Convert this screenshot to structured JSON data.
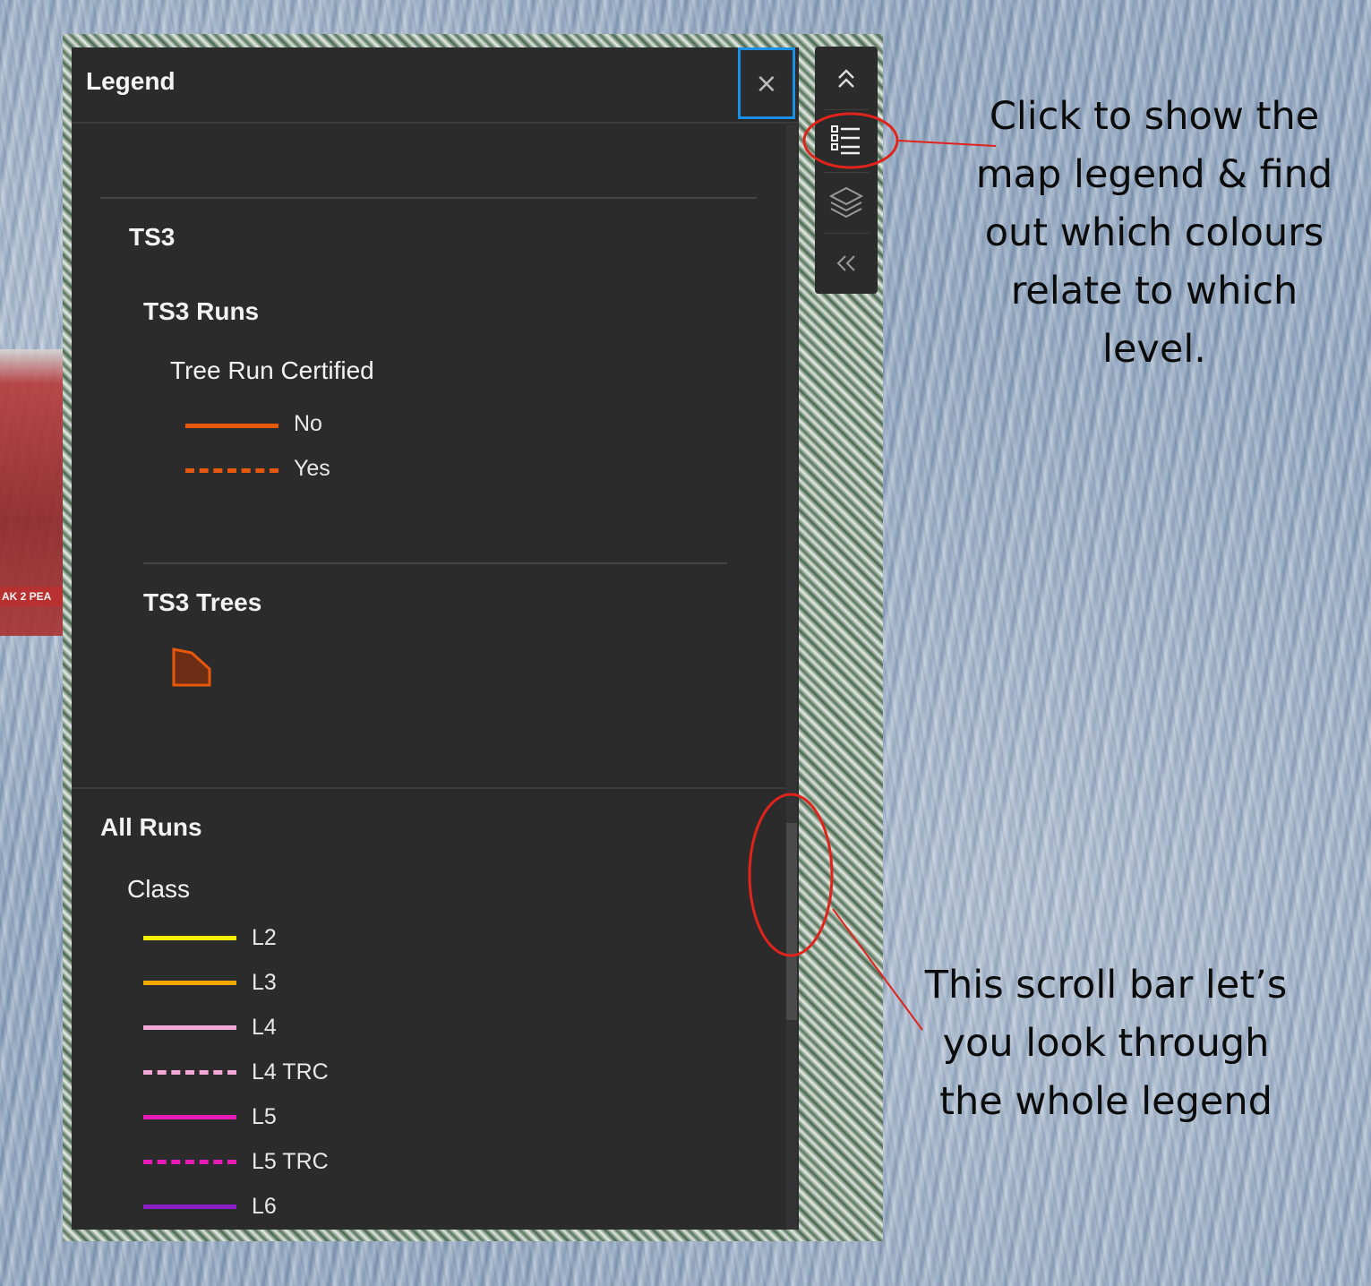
{
  "legend": {
    "title": "Legend",
    "close_label": "×",
    "ts3": {
      "title": "TS3",
      "runs": {
        "title": "TS3 Runs",
        "field": "Tree Run Certified",
        "items": [
          {
            "label": "No",
            "color": "#e8580c",
            "style": "solid"
          },
          {
            "label": "Yes",
            "color": "#e8580c",
            "style": "dashed"
          }
        ]
      },
      "trees": {
        "title": "TS3 Trees",
        "fill_color": "#6b2e14",
        "stroke_color": "#e8580c"
      }
    },
    "all_runs": {
      "title": "All Runs",
      "field": "Class",
      "items": [
        {
          "label": "L2",
          "color": "#f5f000",
          "style": "solid"
        },
        {
          "label": "L3",
          "color": "#f2a800",
          "style": "solid"
        },
        {
          "label": "L4",
          "color": "#f4a8d8",
          "style": "solid"
        },
        {
          "label": "L4 TRC",
          "color": "#f4a8d8",
          "style": "dashed"
        },
        {
          "label": "L5",
          "color": "#e81ab8",
          "style": "solid"
        },
        {
          "label": "L5 TRC",
          "color": "#e81ab8",
          "style": "dashed"
        },
        {
          "label": "L6",
          "color": "#8a1fc8",
          "style": "solid"
        }
      ]
    }
  },
  "toolbar": {
    "buttons": [
      {
        "name": "collapse-up",
        "icon": "double-chevron-up-icon"
      },
      {
        "name": "legend",
        "icon": "legend-list-icon"
      },
      {
        "name": "layers",
        "icon": "layers-icon"
      },
      {
        "name": "collapse-left",
        "icon": "double-chevron-left-icon"
      }
    ]
  },
  "background": {
    "gondola_text": "AK 2 PEA"
  },
  "annotations": {
    "legend_hint": [
      "Click to show the",
      "map legend & find",
      "out which colours",
      "relate to which",
      "level."
    ],
    "scroll_hint": [
      "This scroll bar let’s",
      "you look through",
      "the whole legend"
    ],
    "highlight_color": "#e0231b"
  }
}
